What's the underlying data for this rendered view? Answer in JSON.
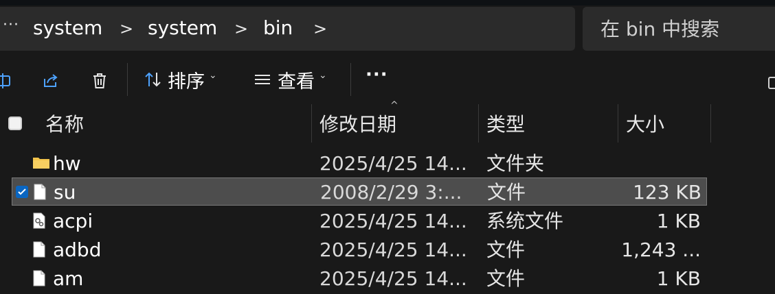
{
  "address": {
    "overflow_label": "···",
    "crumbs": [
      "system",
      "system",
      "bin"
    ],
    "chevron": ">"
  },
  "search": {
    "placeholder": "在 bin 中搜索"
  },
  "toolbar": {
    "sort_label": "排序",
    "view_label": "查看",
    "more_label": "···"
  },
  "columns": {
    "name": "名称",
    "date": "修改日期",
    "type": "类型",
    "size": "大小"
  },
  "files": [
    {
      "name": "hw",
      "date": "2025/4/25 14...",
      "type": "文件夹",
      "size": "",
      "icon": "folder-icon",
      "selected": false
    },
    {
      "name": "su",
      "date": "2008/2/29 3:...",
      "type": "文件",
      "size": "123 KB",
      "icon": "file-icon",
      "selected": true
    },
    {
      "name": "acpi",
      "date": "2025/4/25 14...",
      "type": "系统文件",
      "size": "1 KB",
      "icon": "system-file-icon",
      "selected": false
    },
    {
      "name": "adbd",
      "date": "2025/4/25 14...",
      "type": "文件",
      "size": "1,243 ...",
      "icon": "file-icon",
      "selected": false
    },
    {
      "name": "am",
      "date": "2025/4/25 14...",
      "type": "文件",
      "size": "1 KB",
      "icon": "file-icon",
      "selected": false
    }
  ],
  "colors": {
    "background": "#191919",
    "bar": "#2b2b2b",
    "selection": "#4d4d4d",
    "accent": "#0a66c2",
    "folder": "#f2c34b"
  }
}
